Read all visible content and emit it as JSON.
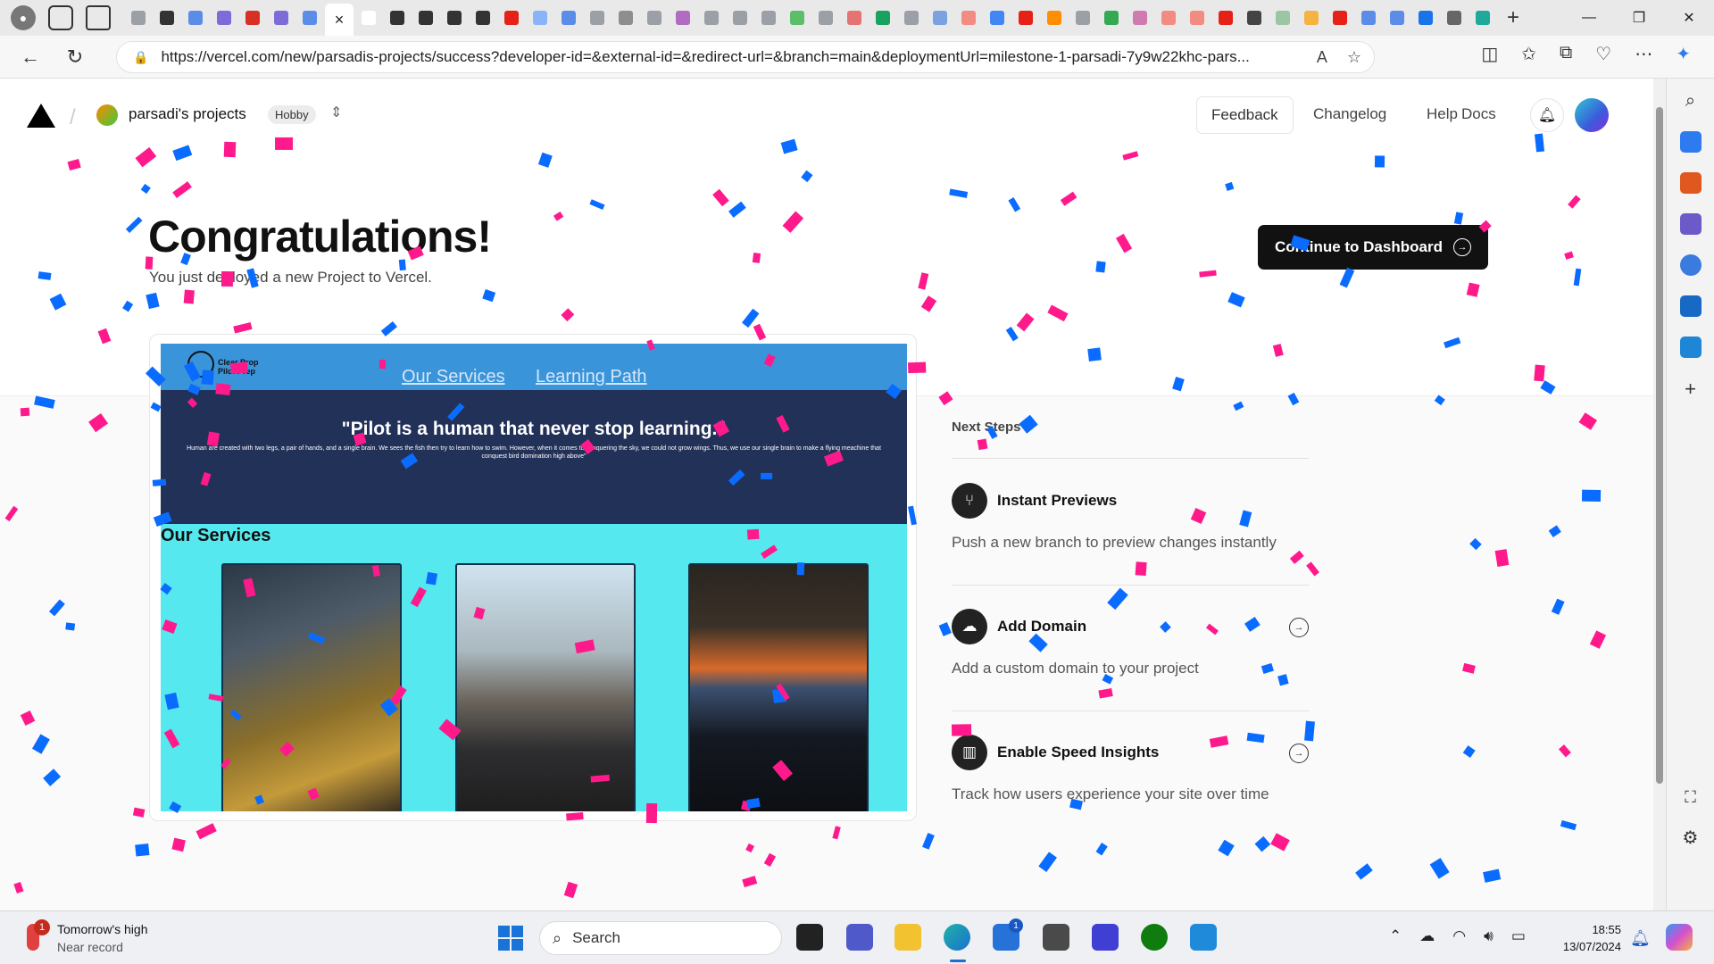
{
  "browser": {
    "active_tab_close": "×",
    "new_tab": "+",
    "url": "https://vercel.com/new/parsadis-projects/success?developer-id=&external-id=&redirect-url=&branch=main&deploymentUrl=milestone-1-parsadi-7y9w22khc-pars...",
    "tab_favicons": [
      "#9aa0a6",
      "#333",
      "#5b8de8",
      "#7d6bd9",
      "#d93025",
      "#7d6bd9",
      "#5b8de8",
      "#fff",
      "#333",
      "#333",
      "#333",
      "#333",
      "#e62117",
      "#8ab4f8",
      "#5b8de8",
      "#9aa0a6",
      "#8e8e8e",
      "#9aa0a6",
      "#b06cc0",
      "#9aa0a6",
      "#9aa0a6",
      "#9aa0a6",
      "#5bbf6a",
      "#9aa0a6",
      "#e57373",
      "#19a15f",
      "#9aa0a6",
      "#7aa1e0",
      "#f28b82",
      "#4285f4",
      "#e62117",
      "#ff8f00",
      "#9aa0a6",
      "#34a853",
      "#cf7bb0",
      "#f28b82",
      "#f28b82",
      "#e62117",
      "#444",
      "#9bc5a3",
      "#f5b342",
      "#e62117",
      "#5b8de8",
      "#5b8de8",
      "#1a73e8",
      "#666",
      "#1fa99a"
    ]
  },
  "vercel": {
    "team_name": "parsadi's projects",
    "plan_badge": "Hobby",
    "nav": {
      "feedback": "Feedback",
      "changelog": "Changelog",
      "help": "Help",
      "docs": "Docs"
    },
    "heading": "Congratulations!",
    "subheading": "You just deployed a new Project to Vercel.",
    "continue_button": "Continue to Dashboard",
    "next_steps_label": "Next Steps",
    "next_steps": [
      {
        "title": "Instant Previews",
        "desc": "Push a new branch to preview changes instantly",
        "icon": "git-branch-icon",
        "glyph": "⑂",
        "has_arrow": false
      },
      {
        "title": "Add Domain",
        "desc": "Add a custom domain to your project",
        "icon": "cloud-icon",
        "glyph": "☁",
        "has_arrow": true
      },
      {
        "title": "Enable Speed Insights",
        "desc": "Track how users experience your site over time",
        "icon": "bar-chart-icon",
        "glyph": "▥",
        "has_arrow": true
      }
    ]
  },
  "preview_site": {
    "brand": "Clear Prop Pilot Prep",
    "brand_line1": "Clear Prop",
    "brand_line2": "Pilot Prep",
    "nav_links": [
      "Our Services",
      "Learning Path"
    ],
    "quote": "\"Pilot is a human that never stop learning.\"",
    "body": "Human are created with two legs, a pair of hands, and a single brain. We sees the fish then try to learn how to swim. However, when it comes to conquering the sky, we could not grow wings. Thus, we use our single brain to make a flying meachine that conquest bird domination high above\"",
    "section_title": "Our Services"
  },
  "taskbar": {
    "weather_title": "Tomorrow's high",
    "weather_sub": "Near record",
    "weather_badge": "1",
    "search_placeholder": "Search",
    "store_badge": "1",
    "time": "18:55",
    "date": "13/07/2024"
  },
  "colors": {
    "confetti_pink": "#ff1a8c",
    "confetti_blue": "#0a6cff",
    "accent": "#111111",
    "preview_nav": "#3a94da",
    "preview_hero": "#223158",
    "preview_bg": "#56e8ef"
  }
}
